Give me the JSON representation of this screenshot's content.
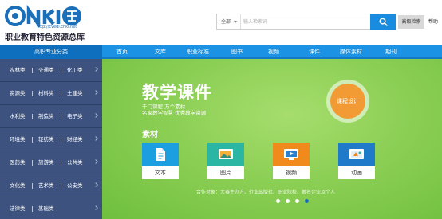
{
  "header": {
    "logo_url": "http://cvedl.cnki.net",
    "logo_subtitle": "职业教育特色资源总库",
    "search": {
      "scope": "全部",
      "placeholder": "输入检索词",
      "button_icon": "search-icon"
    },
    "advanced_search": "高级检索",
    "help": "帮助"
  },
  "nav": {
    "category_title": "高职专业分类",
    "items": [
      "首页",
      "文库",
      "职业标准",
      "图书",
      "视频",
      "课件",
      "媒体素材",
      "期刊"
    ]
  },
  "sidebar": {
    "rows": [
      [
        "农林类",
        "交通类",
        "化工类"
      ],
      [
        "资源类",
        "材料类",
        "土建类"
      ],
      [
        "水利类",
        "制造类",
        "电子类"
      ],
      [
        "环境类",
        "轻纺类",
        "财经类"
      ],
      [
        "医药类",
        "旅游类",
        "公共类"
      ],
      [
        "文化类",
        "艺术类",
        "公安类"
      ],
      [
        "法律类",
        "基础类"
      ]
    ]
  },
  "banner": {
    "title": "教学课件",
    "subtitle_line1": "千门课程   万个素材",
    "subtitle_line2": "名家教学智慧   优秀教学资源",
    "badge": "课程设计",
    "section_label": "素材",
    "cards": [
      {
        "label": "文本",
        "icon": "document-icon",
        "color": "#1b9fe0"
      },
      {
        "label": "图片",
        "icon": "image-icon",
        "color": "#2bb6a4"
      },
      {
        "label": "视频",
        "icon": "video-icon",
        "color": "#f08a1c"
      },
      {
        "label": "动画",
        "icon": "animation-icon",
        "color": "#1f7bc9"
      }
    ],
    "partners": "合作对象：大赛主办方、行业出版社、职业院校、著名企业及个人",
    "carousel": {
      "total": 4,
      "active_index": 3
    }
  },
  "colors": {
    "brand_blue": "#1b92e3",
    "sidebar": "#3d527e",
    "banner_green": "#8ccf55",
    "badge_orange": "#f29b34"
  }
}
